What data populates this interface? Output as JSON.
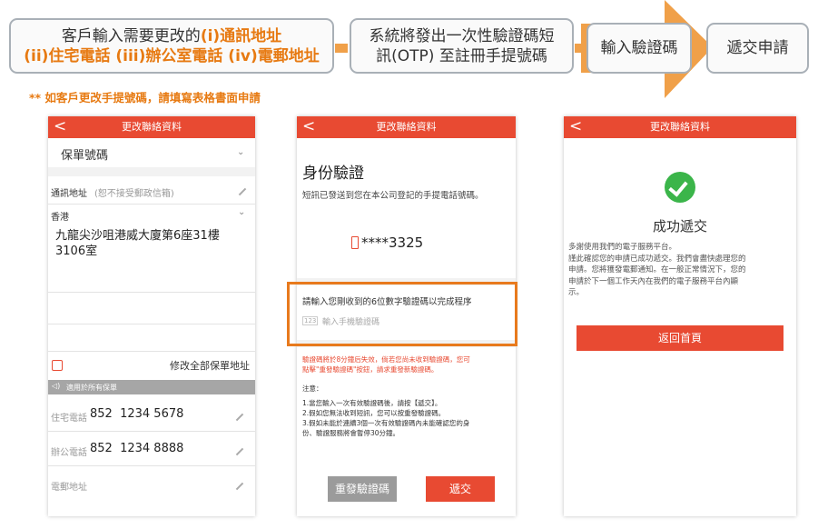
{
  "flow": {
    "step1": {
      "line1_prefix": "客戶輸入需要更改的",
      "line1_highlight": "(i)通訊地址",
      "line2_highlight": "(ii)住宅電話 (iii)辦公室電話 (iv)電郵地址"
    },
    "step2": {
      "line1": "系統將發出一次性驗證碼短",
      "line2": "訊(OTP) 至註冊手提號碼"
    },
    "step3": {
      "label": "輸入驗證碼"
    },
    "step4": {
      "label": "遞交申請"
    }
  },
  "note": "** 如客戶更改手提號碼，請填寫表格書面申請",
  "screen1": {
    "title": "更改聯絡資料",
    "policy_label": "保單號碼",
    "address_label": "通訊地址",
    "address_hint": "(恕不接受郵政信箱)",
    "region": "香港",
    "address_line1": "九龍尖沙咀港威大廈第6座31樓",
    "address_line2": "3106室",
    "modify_all_label": "修改全部保單地址",
    "apply_all": "適用於所有保單",
    "home_phone_label": "住宅電話",
    "home_phone": "852  1234 5678",
    "office_phone_label": "辦公電話",
    "office_phone": "852  1234 8888",
    "email_label": "電郵地址"
  },
  "screen2": {
    "title": "更改聯絡資料",
    "heading": "身份驗證",
    "sent_text": "短訊已發送到您在本公司登記的手提電話號碼。",
    "masked_number": "****3325",
    "prompt": "請輸入您剛收到的6位數字驗證碼以完成程序",
    "input_placeholder": "輸入手機驗證碼",
    "warning_line1": "驗證碼將於8分鐘后失效，倘若您尚未收到驗證碼，您可",
    "warning_line2": "點擊\"重發驗證碼\"按鈕，請求重發新驗證碼。",
    "notes_title": "注意：",
    "notes": [
      "1.當您輸入一次有效驗證碼後，請按【遞交】。",
      "2.假如您無法收到短訊，您可以按重發驗證碼。",
      "3.假如未能於連續3個一次有效驗證碼內未能確認您的身",
      "份、驗證服務將會暫停30分鐘。"
    ],
    "resend_button": "重發驗證碼",
    "submit_button": "遞交"
  },
  "screen3": {
    "title": "更改聯絡資料",
    "success_title": "成功遞交",
    "message_lines": [
      "多謝使用我們的電子服務平台。",
      "謹此確認您的申請已成功遞交。我們會盡快處理您的",
      "申請。您將獲發電郵通知。在一般正常情況下，您的",
      "申請於下一個工作天內在我們的電子服務平台內顯",
      "示。"
    ],
    "home_button": "返回首頁"
  },
  "colors": {
    "accent": "#e77a12",
    "header_red": "#e84a32",
    "success_green": "#3bb54a"
  }
}
